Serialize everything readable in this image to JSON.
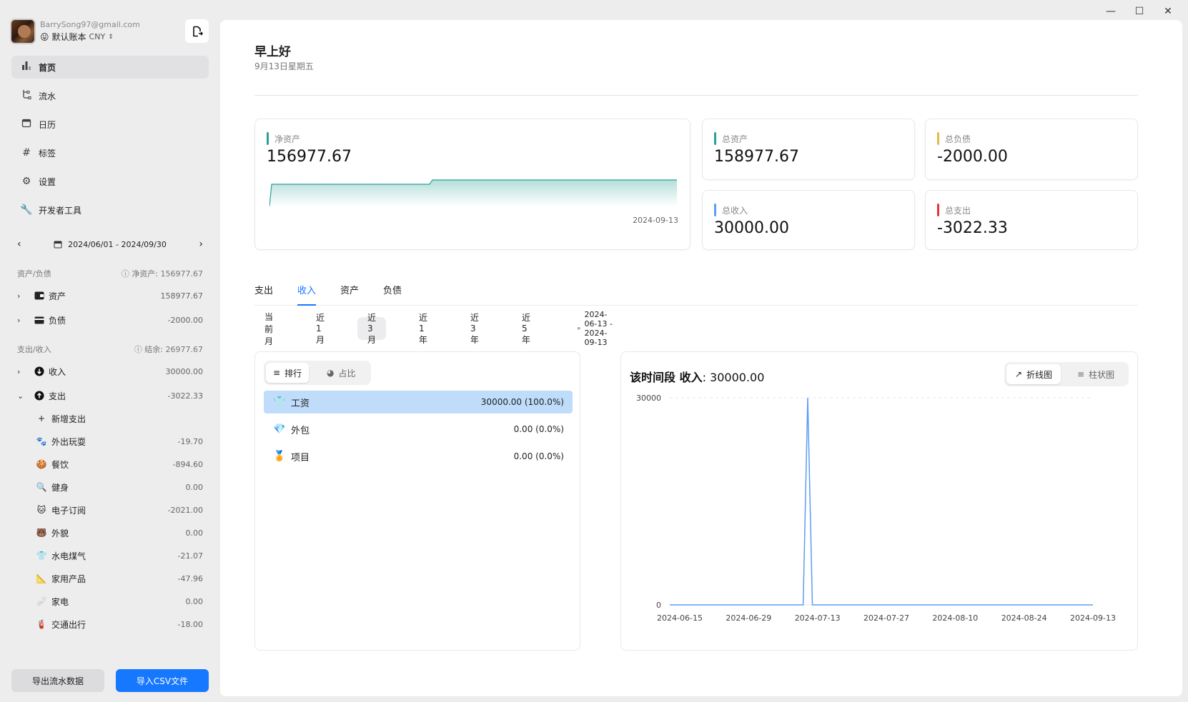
{
  "window": {
    "minimize": "—",
    "maximize": "☐",
    "close": "✕"
  },
  "account": {
    "email": "BarrySong97@gmail.com",
    "book": "默认账本",
    "currency": "CNY",
    "book_emoji": "😛"
  },
  "nav": [
    {
      "label": "首页",
      "icon": "bar-chart-icon",
      "active": true
    },
    {
      "label": "流水",
      "icon": "flow-icon"
    },
    {
      "label": "日历",
      "icon": "calendar-icon"
    },
    {
      "label": "标签",
      "icon": "hash-icon"
    },
    {
      "label": "设置",
      "icon": "gear-icon"
    },
    {
      "label": "开发者工具",
      "icon": "wrench-icon"
    }
  ],
  "date_range": "2024/06/01 - 2024/09/30",
  "assets_section": {
    "title": "资产/负债",
    "summary": "净资产: 156977.67"
  },
  "assets": [
    {
      "label": "资产",
      "value": "158977.67"
    },
    {
      "label": "负债",
      "value": "-2000.00"
    }
  ],
  "io_section": {
    "title": "支出/收入",
    "summary": "结余: 26977.67"
  },
  "io": [
    {
      "label": "收入",
      "value": "30000.00"
    },
    {
      "label": "支出",
      "value": "-3022.33"
    }
  ],
  "add_expense": "新增支出",
  "expense_items": [
    {
      "label": "外出玩耍",
      "value": "-19.70",
      "icon": "🐾"
    },
    {
      "label": "餐饮",
      "value": "-894.60",
      "icon": "🍪"
    },
    {
      "label": "健身",
      "value": "0.00",
      "icon": "🔍"
    },
    {
      "label": "电子订阅",
      "value": "-2021.00",
      "icon": "🐱"
    },
    {
      "label": "外貌",
      "value": "0.00",
      "icon": "🐻"
    },
    {
      "label": "水电煤气",
      "value": "-21.07",
      "icon": "👕"
    },
    {
      "label": "家用产品",
      "value": "-47.96",
      "icon": "📐"
    },
    {
      "label": "家电",
      "value": "0.00",
      "icon": "🩹"
    },
    {
      "label": "交通出行",
      "value": "-18.00",
      "icon": "🧯"
    }
  ],
  "buttons": {
    "export": "导出流水数据",
    "import": "导入CSV文件"
  },
  "main": {
    "greeting": "早上好",
    "date": "9月13日星期五"
  },
  "cards": {
    "net": {
      "title": "净资产",
      "value": "156977.67",
      "date": "2024-09-13",
      "color": "#2aa198"
    },
    "total_assets": {
      "title": "总资产",
      "value": "158977.67",
      "color": "#2aa198"
    },
    "total_debt": {
      "title": "总负债",
      "value": "-2000.00",
      "color": "#e6b84a"
    },
    "total_income": {
      "title": "总收入",
      "value": "30000.00",
      "color": "#5b9df5"
    },
    "total_expense": {
      "title": "总支出",
      "value": "-3022.33",
      "color": "#e5343d"
    }
  },
  "tabs": [
    "支出",
    "收入",
    "资产",
    "负债"
  ],
  "active_tab": "收入",
  "ranges": [
    "当前月",
    "近1月",
    "近3月",
    "近1年",
    "近3年",
    "近5年"
  ],
  "active_range": "近3月",
  "range_dates": "2024-06-13 - 2024-09-13",
  "rank": {
    "seg_rank": "排行",
    "seg_share": "占比",
    "rows": [
      {
        "name": "工资",
        "value": "30000.00 (100.0%)",
        "icon": "👕"
      },
      {
        "name": "外包",
        "value": "0.00 (0.0%)",
        "icon": "💎"
      },
      {
        "name": "项目",
        "value": "0.00 (0.0%)",
        "icon": "🏅"
      }
    ]
  },
  "chart_panel": {
    "title_bold": "该时间段 收入",
    "title_value": ": 30000.00",
    "seg_line": "折线图",
    "seg_bar": "柱状图"
  },
  "chart_data": {
    "type": "line",
    "x": [
      "2024-06-15",
      "2024-06-29",
      "2024-07-13",
      "2024-07-27",
      "2024-08-10",
      "2024-08-24",
      "2024-09-13"
    ],
    "x_ticks": [
      "2024-06-15",
      "2024-06-29",
      "2024-07-13",
      "2024-07-27",
      "2024-08-10",
      "2024-08-24",
      "2024-09-13"
    ],
    "y_ticks": [
      "0",
      "30000"
    ],
    "ylim": [
      0,
      30000
    ],
    "series": [
      {
        "points": [
          [
            "2024-06-13",
            0
          ],
          [
            "2024-07-12",
            0
          ],
          [
            "2024-07-13",
            30000
          ],
          [
            "2024-07-14",
            0
          ],
          [
            "2024-09-13",
            0
          ]
        ]
      }
    ],
    "color": "#5b9df5"
  }
}
